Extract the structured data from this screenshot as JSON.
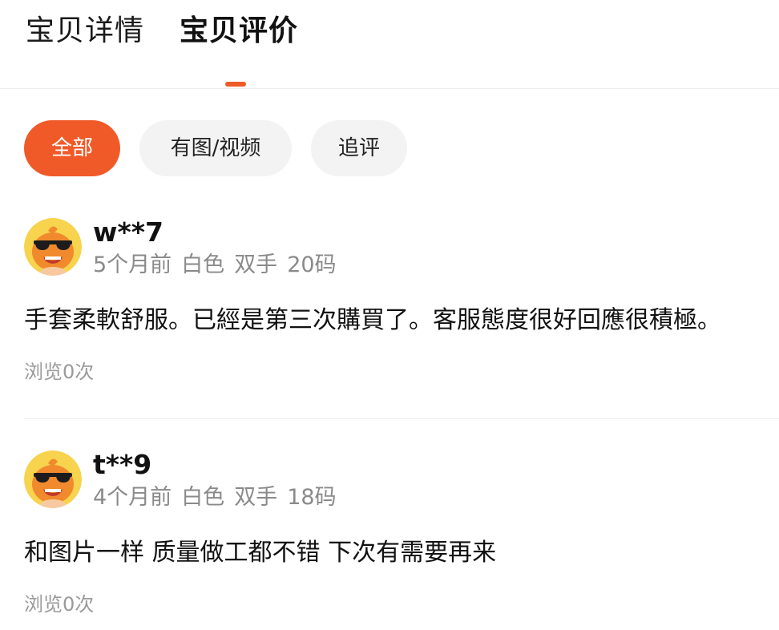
{
  "tabs": [
    {
      "label": "宝贝详情",
      "active": false
    },
    {
      "label": "宝贝评价",
      "active": true
    }
  ],
  "accent_color": "#f05a28",
  "filters": [
    {
      "label": "全部",
      "selected": true
    },
    {
      "label": "有图/视频",
      "selected": false
    },
    {
      "label": "追评",
      "selected": false
    }
  ],
  "reviews": [
    {
      "user": "w**7",
      "avatar_icon": "orange-sunglasses-mascot-avatar",
      "time": "5个月前",
      "color": "白色",
      "style": "双手",
      "size": "20码",
      "text": "手套柔軟舒服。已經是第三次購買了。客服態度很好回應很積極。",
      "views": "浏览0次"
    },
    {
      "user": "t**9",
      "avatar_icon": "orange-sunglasses-mascot-avatar",
      "time": "4个月前",
      "color": "白色",
      "style": "双手",
      "size": "18码",
      "text": "和图片一样 质量做工都不错 下次有需要再来",
      "views": "浏览0次"
    }
  ]
}
